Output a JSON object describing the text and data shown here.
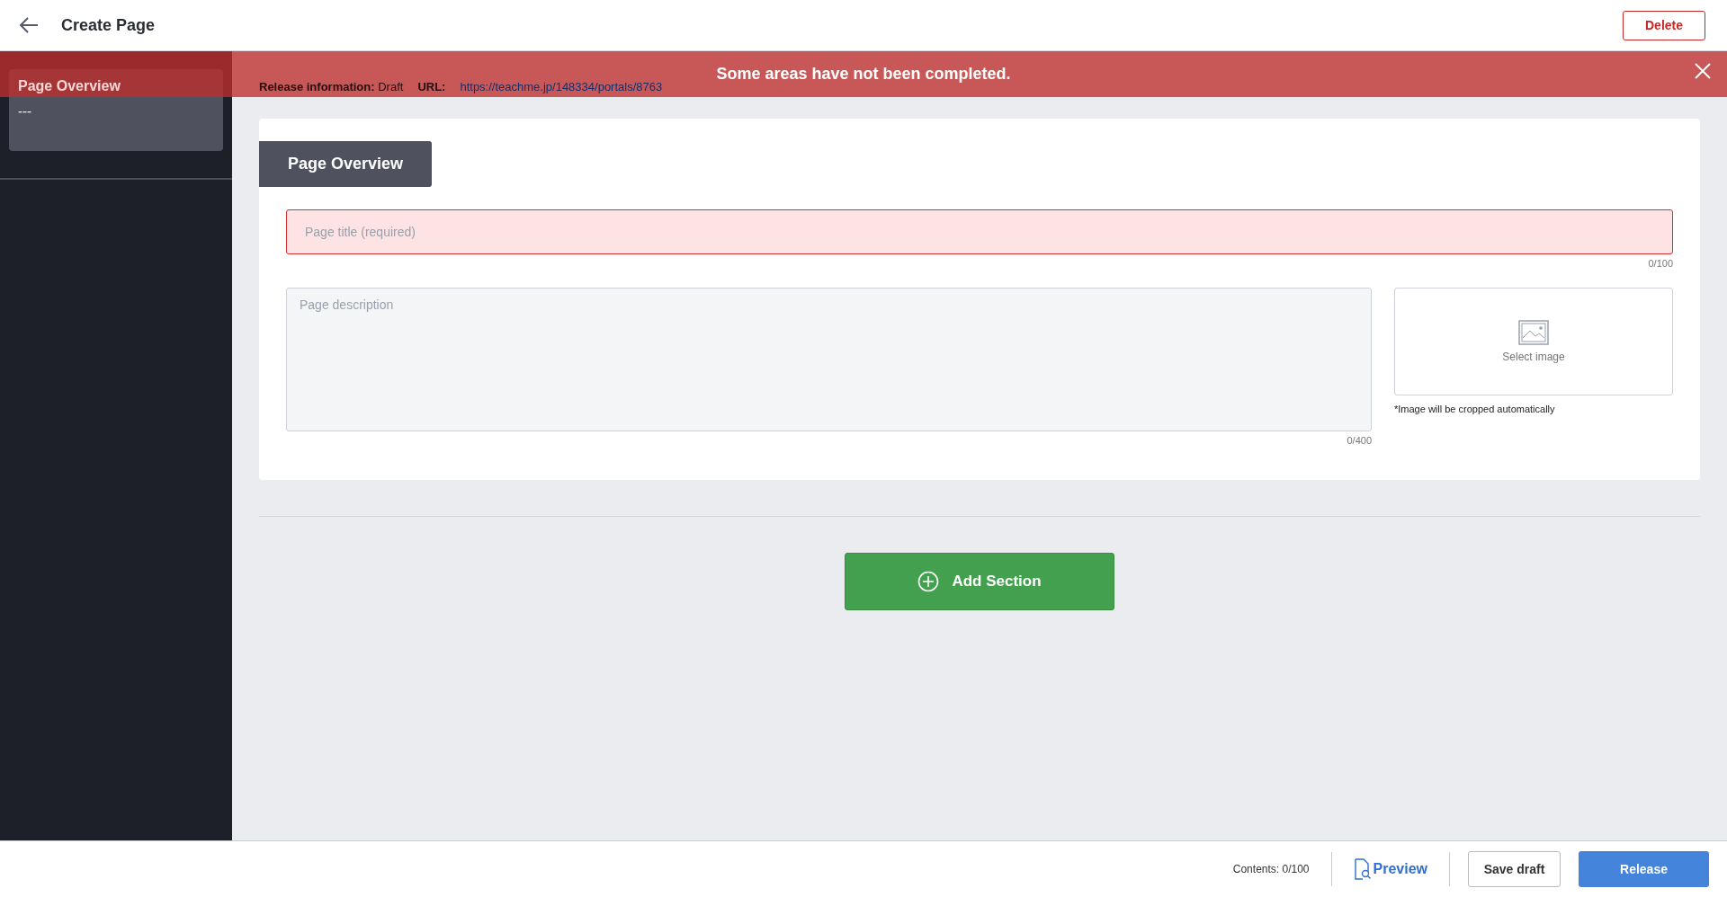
{
  "header": {
    "title": "Create Page",
    "delete_button": "Delete"
  },
  "alert": {
    "message": "Some areas have not been completed."
  },
  "sidebar": {
    "items": [
      {
        "title": "Page Overview",
        "subtitle": "---",
        "selected": true
      }
    ]
  },
  "release_info": {
    "status_label": "Release information:",
    "status": "Draft",
    "url_label": "URL:",
    "url": "https://teachme.jp/148334/portals/8763"
  },
  "editor": {
    "tab": "Page Overview",
    "title_field": {
      "placeholder": "Page title (required)",
      "counter": "0/100",
      "error": true
    },
    "description_field": {
      "placeholder": "Page description",
      "counter": "0/400"
    },
    "image": {
      "label": "Select image",
      "note": "*Image will be cropped automatically"
    }
  },
  "add_section_button": "Add Section",
  "footer": {
    "contents": "Contents: 0/100",
    "preview": "Preview",
    "save_draft": "Save draft",
    "release": "Release"
  }
}
